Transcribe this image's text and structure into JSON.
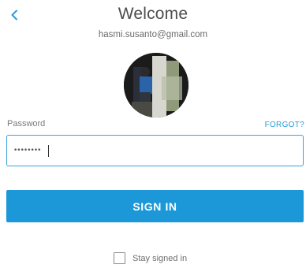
{
  "header": {
    "back_icon": "chevron-left-icon",
    "title": "Welcome",
    "email": "hasmi.susanto@gmail.com"
  },
  "avatar": {
    "icon": "user-photo"
  },
  "password": {
    "label": "Password",
    "value": "••••••••",
    "forgot_label": "FORGOT?"
  },
  "actions": {
    "signin_label": "SIGN IN"
  },
  "stay_signed_in": {
    "label": "Stay signed in",
    "checked": false
  },
  "colors": {
    "accent": "#1c98d8",
    "link": "#2a9bd8",
    "border": "#3fa1dc"
  }
}
